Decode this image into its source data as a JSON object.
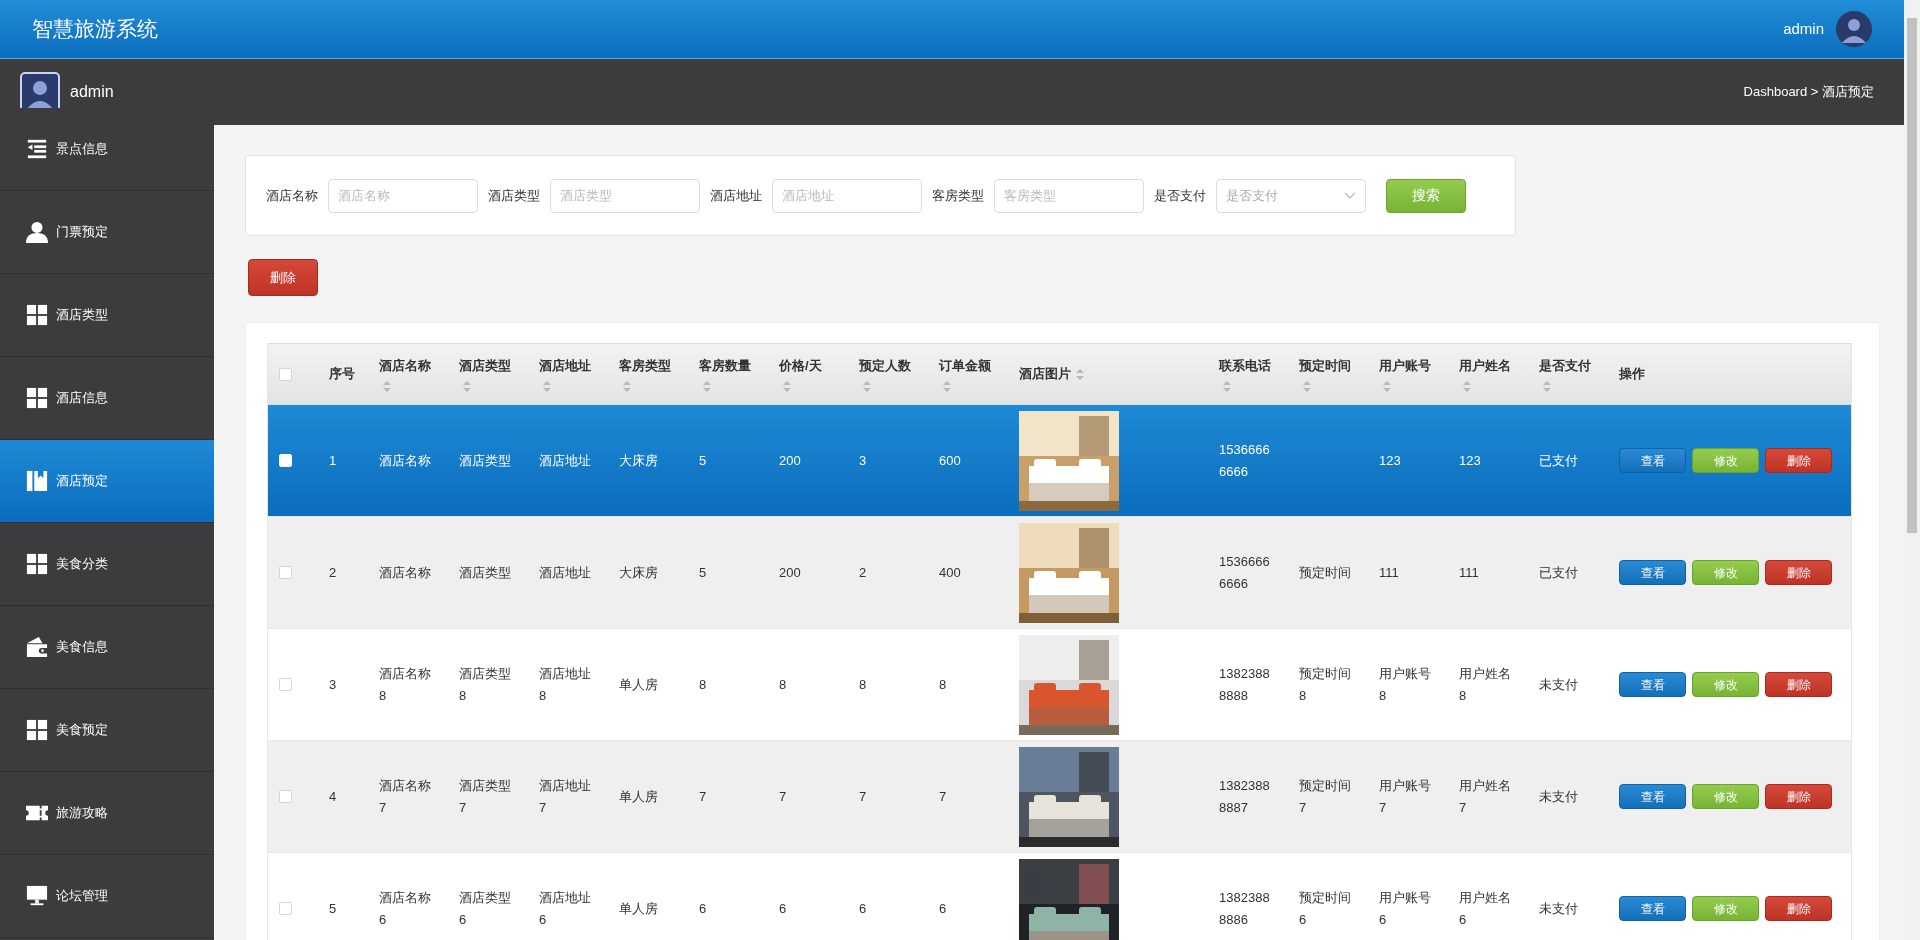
{
  "header": {
    "title": "智慧旅游系统",
    "user": "admin"
  },
  "subbar": {
    "user": "admin",
    "breadcrumb": "Dashboard > 酒店预定"
  },
  "sidebar": {
    "items": [
      {
        "label": "景点信息",
        "selected": false
      },
      {
        "label": "门票预定",
        "selected": false
      },
      {
        "label": "酒店类型",
        "selected": false
      },
      {
        "label": "酒店信息",
        "selected": false
      },
      {
        "label": "酒店预定",
        "selected": true
      },
      {
        "label": "美食分类",
        "selected": false
      },
      {
        "label": "美食信息",
        "selected": false
      },
      {
        "label": "美食预定",
        "selected": false
      },
      {
        "label": "旅游攻略",
        "selected": false
      },
      {
        "label": "论坛管理",
        "selected": false
      }
    ]
  },
  "search": {
    "fields": [
      {
        "kind": "text",
        "label": "酒店名称",
        "placeholder": "酒店名称"
      },
      {
        "kind": "text",
        "label": "酒店类型",
        "placeholder": "酒店类型"
      },
      {
        "kind": "text",
        "label": "酒店地址",
        "placeholder": "酒店地址"
      },
      {
        "kind": "text",
        "label": "客房类型",
        "placeholder": "客房类型"
      },
      {
        "kind": "select",
        "label": "是否支付",
        "placeholder": "是否支付"
      }
    ],
    "button": "搜索"
  },
  "delete_button": "删除",
  "table": {
    "header_checked": false,
    "columns": [
      {
        "kind": "plain",
        "label": "序号"
      },
      {
        "kind": "sortable",
        "label": "酒店名称"
      },
      {
        "kind": "sortable",
        "label": "酒店类型"
      },
      {
        "kind": "sortable",
        "label": "酒店地址"
      },
      {
        "kind": "sortable",
        "label": "客房类型"
      },
      {
        "kind": "sortable",
        "label": "客房数量"
      },
      {
        "kind": "sortable",
        "label": "价格/天"
      },
      {
        "kind": "sortable",
        "label": "预定人数"
      },
      {
        "kind": "sortable",
        "label": "订单金额"
      },
      {
        "kind": "sortinline",
        "label": "酒店图片"
      },
      {
        "kind": "sortable",
        "label": "联系电话"
      },
      {
        "kind": "sortable",
        "label": "预定时间"
      },
      {
        "kind": "sortable",
        "label": "用户账号"
      },
      {
        "kind": "sortable",
        "label": "用户姓名"
      },
      {
        "kind": "sortable",
        "label": "是否支付"
      },
      {
        "kind": "plain",
        "label": "操作"
      }
    ],
    "rows": [
      {
        "selected": true,
        "checked": false,
        "cells": [
          "1",
          "酒店名称",
          "酒店类型",
          "酒店地址",
          "大床房",
          "5",
          "200",
          "3",
          "600",
          {
            "kind": "picture"
          },
          "15366666666",
          null,
          "123",
          "123",
          "已支付"
        ],
        "actions": [
          {
            "kind": "view",
            "label": "查看"
          },
          {
            "kind": "edit",
            "label": "修改"
          },
          {
            "kind": "delete",
            "label": "删除"
          }
        ]
      },
      {
        "selected": false,
        "checked": false,
        "cells": [
          "2",
          "酒店名称",
          "酒店类型",
          "酒店地址",
          "大床房",
          "5",
          "200",
          "2",
          "400",
          {
            "kind": "picture"
          },
          "15366666666",
          "预定时间",
          "111",
          "111",
          "已支付"
        ],
        "actions": [
          {
            "kind": "view",
            "label": "查看"
          },
          {
            "kind": "edit",
            "label": "修改"
          },
          {
            "kind": "delete",
            "label": "删除"
          }
        ]
      },
      {
        "selected": false,
        "checked": false,
        "cells": [
          "3",
          "酒店名称8",
          "酒店类型8",
          "酒店地址8",
          "单人房",
          "8",
          "8",
          "8",
          "8",
          {
            "kind": "picture"
          },
          "13823888888",
          "预定时间8",
          "用户账号8",
          "用户姓名8",
          "未支付"
        ],
        "actions": [
          {
            "kind": "view",
            "label": "查看"
          },
          {
            "kind": "edit",
            "label": "修改"
          },
          {
            "kind": "delete",
            "label": "删除"
          }
        ]
      },
      {
        "selected": false,
        "checked": false,
        "cells": [
          "4",
          "酒店名称7",
          "酒店类型7",
          "酒店地址7",
          "单人房",
          "7",
          "7",
          "7",
          "7",
          {
            "kind": "picture"
          },
          "13823888887",
          "预定时间7",
          "用户账号7",
          "用户姓名7",
          "未支付"
        ],
        "actions": [
          {
            "kind": "view",
            "label": "查看"
          },
          {
            "kind": "edit",
            "label": "修改"
          },
          {
            "kind": "delete",
            "label": "删除"
          }
        ]
      },
      {
        "selected": false,
        "checked": false,
        "cells": [
          "5",
          "酒店名称6",
          "酒店类型6",
          "酒店地址6",
          "单人房",
          "6",
          "6",
          "6",
          "6",
          {
            "kind": "picture"
          },
          "13823888886",
          "预定时间6",
          "用户账号6",
          "用户姓名6",
          "未支付"
        ],
        "actions": [
          {
            "kind": "view",
            "label": "查看"
          },
          {
            "kind": "edit",
            "label": "修改"
          },
          {
            "kind": "delete",
            "label": "删除"
          }
        ]
      }
    ]
  }
}
